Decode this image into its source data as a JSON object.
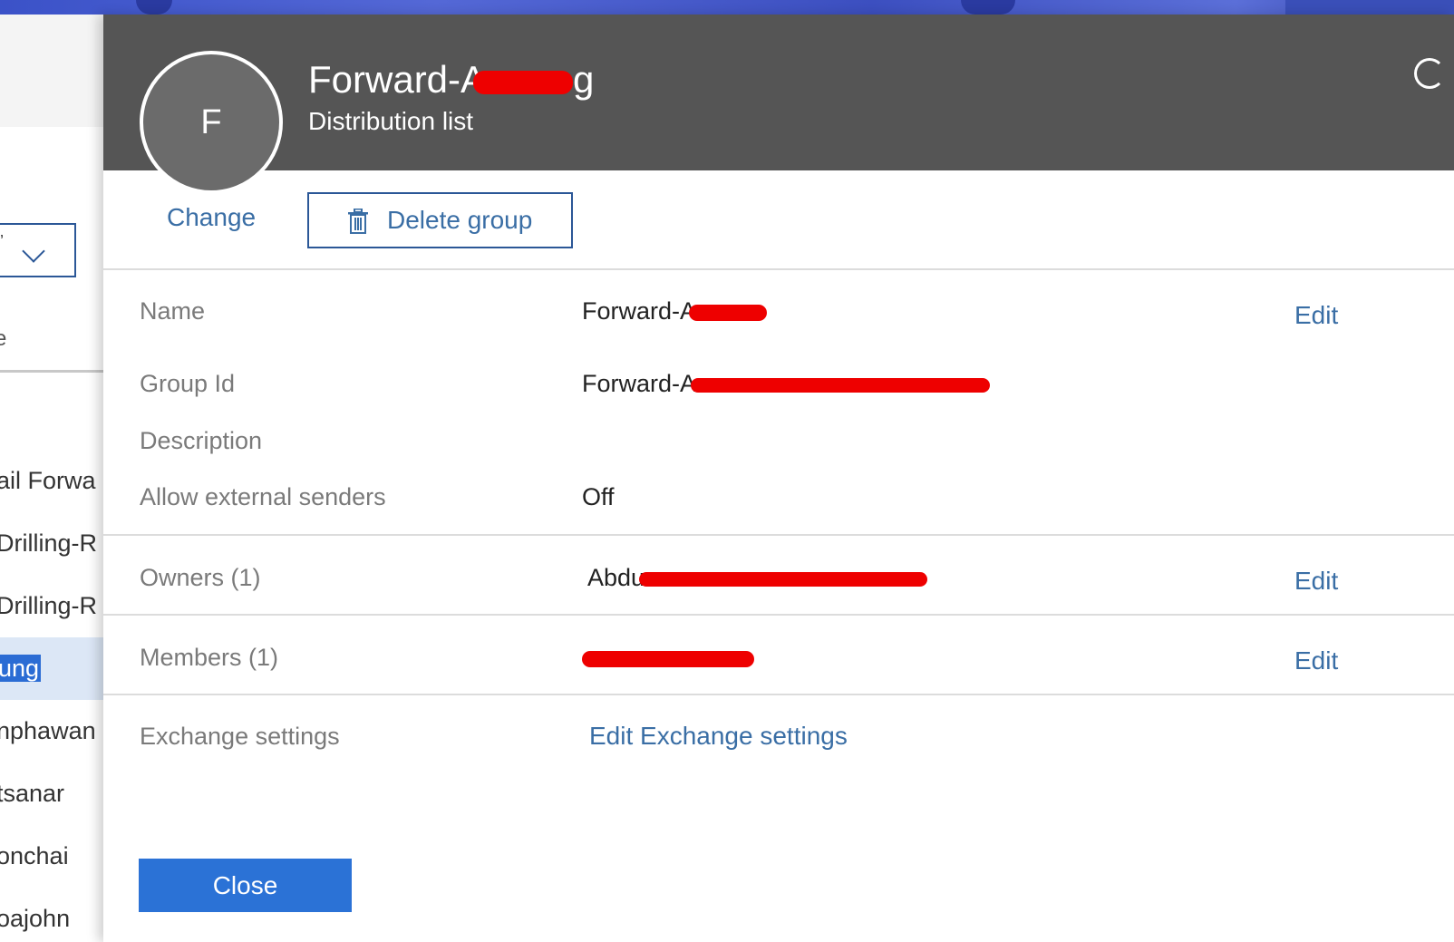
{
  "background_list": {
    "column_label": "e",
    "items": [
      {
        "label": "ail Forwa",
        "selected": false
      },
      {
        "label": "Drilling-R",
        "selected": false
      },
      {
        "label": "Drilling-R",
        "selected": false
      },
      {
        "label": "ung",
        "selected": true
      },
      {
        "label": "nphawan",
        "selected": false
      },
      {
        "label": "tsanar",
        "selected": false
      },
      {
        "label": "onchai",
        "selected": false
      },
      {
        "label": "oajohn",
        "selected": false
      }
    ]
  },
  "panel": {
    "avatar_initial": "F",
    "title_visible": "Forward-A",
    "title_tail": "g",
    "subtitle": "Distribution list",
    "change_label": "Change",
    "delete_label": "Delete group",
    "rows": {
      "name": {
        "label": "Name",
        "value": "Forward-A",
        "edit": "Edit"
      },
      "group_id": {
        "label": "Group Id",
        "value": "Forward-A"
      },
      "description": {
        "label": "Description",
        "value": ""
      },
      "allow_external": {
        "label": "Allow external senders",
        "value": "Off"
      },
      "owners": {
        "label": "Owners (1)",
        "value": "Abdu",
        "edit": "Edit"
      },
      "members": {
        "label": "Members (1)",
        "value": "",
        "edit": "Edit"
      },
      "exchange": {
        "label": "Exchange settings",
        "link": "Edit Exchange settings"
      }
    },
    "close_label": "Close"
  },
  "colors": {
    "header_bg": "#555555",
    "accent_link": "#3a6ea5",
    "primary_button": "#2b72d6",
    "redaction": "#ee0000"
  }
}
